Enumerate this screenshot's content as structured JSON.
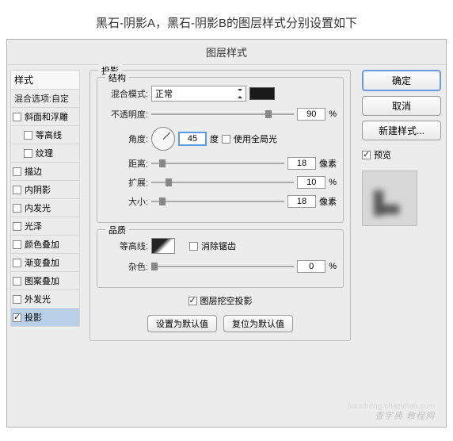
{
  "header": "黑石-阴影A，黑石-阴影B的图层样式分别设置如下",
  "dialog_title": "图层样式",
  "sidebar": {
    "styles_header": "样式",
    "blend_options": "混合选项:自定",
    "items": [
      {
        "label": "斜面和浮雕",
        "checked": false,
        "indent": false
      },
      {
        "label": "等高线",
        "checked": false,
        "indent": true
      },
      {
        "label": "纹理",
        "checked": false,
        "indent": true
      },
      {
        "label": "描边",
        "checked": false,
        "indent": false
      },
      {
        "label": "内阴影",
        "checked": false,
        "indent": false
      },
      {
        "label": "内发光",
        "checked": false,
        "indent": false
      },
      {
        "label": "光泽",
        "checked": false,
        "indent": false
      },
      {
        "label": "颜色叠加",
        "checked": false,
        "indent": false
      },
      {
        "label": "渐变叠加",
        "checked": false,
        "indent": false
      },
      {
        "label": "图案叠加",
        "checked": false,
        "indent": false
      },
      {
        "label": "外发光",
        "checked": false,
        "indent": false
      },
      {
        "label": "投影",
        "checked": true,
        "indent": false,
        "selected": true
      }
    ]
  },
  "main": {
    "section_title": "投影",
    "structure": {
      "title": "结构",
      "blend_mode_label": "混合模式:",
      "blend_mode_value": "正常",
      "color": "#1a1a1a",
      "opacity_label": "不透明度:",
      "opacity_value": "90",
      "opacity_unit": "%",
      "angle_label": "角度:",
      "angle_value": "45",
      "angle_unit": "度",
      "global_light": "使用全局光",
      "distance_label": "距离:",
      "distance_value": "18",
      "distance_unit": "像素",
      "spread_label": "扩展:",
      "spread_value": "10",
      "spread_unit": "%",
      "size_label": "大小:",
      "size_value": "18",
      "size_unit": "像素"
    },
    "quality": {
      "title": "品质",
      "contour_label": "等高线:",
      "antialias": "消除锯齿",
      "noise_label": "杂色:",
      "noise_value": "0",
      "noise_unit": "%"
    },
    "knockout": "图层挖空投影",
    "btn_default": "设置为默认值",
    "btn_reset": "复位为默认值"
  },
  "right": {
    "ok": "确定",
    "cancel": "取消",
    "new_style": "新建样式...",
    "preview": "预览"
  },
  "watermark": "查字典 教程网",
  "watermark2": "jiaocheng.chazidian.com"
}
